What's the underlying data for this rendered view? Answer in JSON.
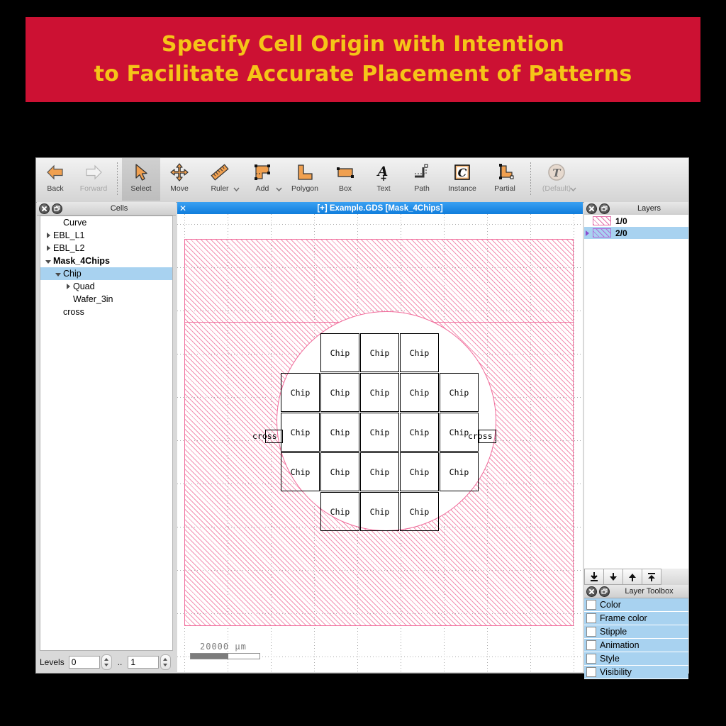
{
  "banner": {
    "line1": "Specify Cell Origin with Intention",
    "line2": "to Facilitate Accurate Placement of Patterns",
    "bg_color": "#cc1133",
    "text_color": "#f5c518"
  },
  "toolbar": {
    "items": [
      {
        "label": "Back",
        "icon": "back-arrow-icon",
        "state": "enabled",
        "dropdown": false
      },
      {
        "label": "Forward",
        "icon": "forward-arrow-icon",
        "state": "disabled",
        "dropdown": false
      },
      {
        "label": "Select",
        "icon": "cursor-icon",
        "state": "selected",
        "dropdown": false
      },
      {
        "label": "Move",
        "icon": "move-cross-icon",
        "state": "enabled",
        "dropdown": false
      },
      {
        "label": "Ruler",
        "icon": "ruler-icon",
        "state": "enabled",
        "dropdown": true
      },
      {
        "label": "Add",
        "icon": "add-shape-icon",
        "state": "enabled",
        "dropdown": true
      },
      {
        "label": "Polygon",
        "icon": "polygon-icon",
        "state": "enabled",
        "dropdown": false
      },
      {
        "label": "Box",
        "icon": "box-icon",
        "state": "enabled",
        "dropdown": false
      },
      {
        "label": "Text",
        "icon": "text-a-icon",
        "state": "enabled",
        "dropdown": false
      },
      {
        "label": "Path",
        "icon": "path-icon",
        "state": "enabled",
        "dropdown": false
      },
      {
        "label": "Instance",
        "icon": "instance-c-icon",
        "state": "enabled",
        "dropdown": false
      },
      {
        "label": "Partial",
        "icon": "partial-icon",
        "state": "enabled",
        "dropdown": false
      },
      {
        "label": "(Default)",
        "icon": "technology-t-icon",
        "state": "disabled",
        "dropdown": true
      }
    ]
  },
  "cells_panel": {
    "title": "Cells",
    "tree": [
      {
        "label": "Curve",
        "indent": 1,
        "twisty": "none",
        "selected": false,
        "bold": false
      },
      {
        "label": "EBL_L1",
        "indent": 0,
        "twisty": "collapsed",
        "selected": false,
        "bold": false
      },
      {
        "label": "EBL_L2",
        "indent": 0,
        "twisty": "collapsed",
        "selected": false,
        "bold": false
      },
      {
        "label": "Mask_4Chips",
        "indent": 0,
        "twisty": "expanded",
        "selected": false,
        "bold": true
      },
      {
        "label": "Chip",
        "indent": 1,
        "twisty": "expanded",
        "selected": true,
        "bold": false
      },
      {
        "label": "Quad",
        "indent": 2,
        "twisty": "collapsed",
        "selected": false,
        "bold": false
      },
      {
        "label": "Wafer_3in",
        "indent": 2,
        "twisty": "none",
        "selected": false,
        "bold": false
      },
      {
        "label": "cross",
        "indent": 1,
        "twisty": "none",
        "selected": false,
        "bold": false
      }
    ],
    "levels_label": "Levels",
    "level_min": "0",
    "level_max": "1",
    "range_separator": ".."
  },
  "canvas": {
    "tab_title": "[+] Example.GDS [Mask_4Chips]",
    "tab_close_icon": "close-icon",
    "scale_value": "20000  µm",
    "mask_color": "#f06c9b",
    "chip_label": "Chip",
    "cross_label": "cross",
    "chip_rows": [
      3,
      5,
      5,
      5,
      3
    ],
    "cross_count": 2
  },
  "layers_panel": {
    "title": "Layers",
    "layers": [
      {
        "name": "1/0",
        "swatch": "pink",
        "selected": false,
        "expandable": false
      },
      {
        "name": "2/0",
        "swatch": "purple",
        "selected": true,
        "expandable": true
      }
    ],
    "buttons": [
      {
        "icon": "move-to-bottom-icon"
      },
      {
        "icon": "move-down-icon"
      },
      {
        "icon": "move-up-icon"
      },
      {
        "icon": "move-to-top-icon"
      }
    ]
  },
  "layer_toolbox": {
    "title": "Layer Toolbox",
    "items": [
      {
        "label": "Color",
        "checked": false
      },
      {
        "label": "Frame color",
        "checked": false
      },
      {
        "label": "Stipple",
        "checked": false
      },
      {
        "label": "Animation",
        "checked": false
      },
      {
        "label": "Style",
        "checked": false
      },
      {
        "label": "Visibility",
        "checked": false
      }
    ]
  }
}
